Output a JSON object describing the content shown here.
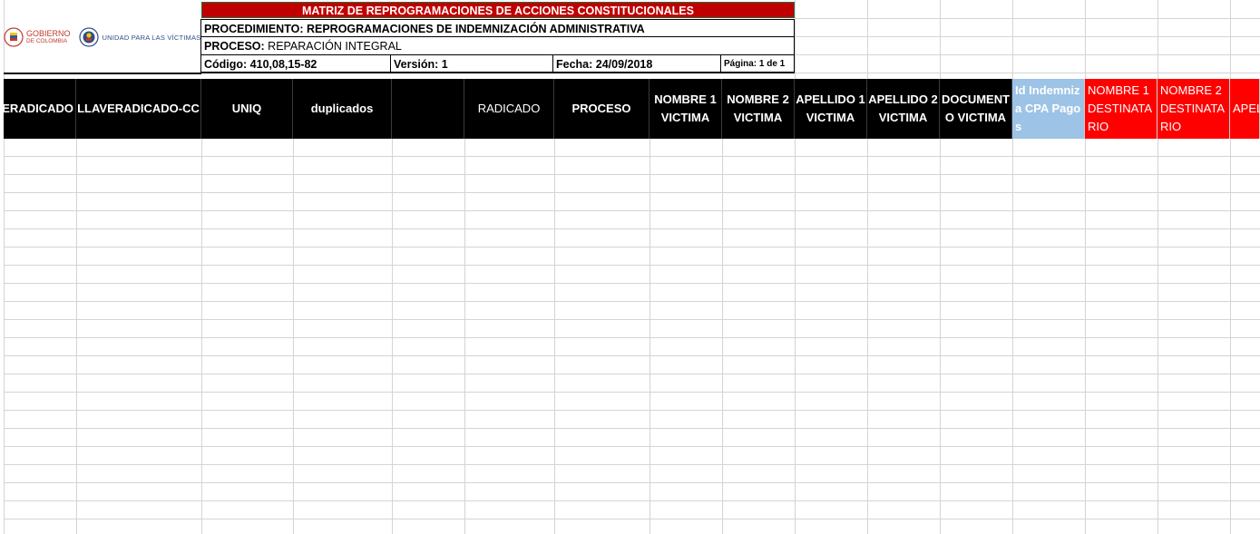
{
  "logos": {
    "gobierno_line1": "GOBIERNO",
    "gobierno_line2": "DE COLOMBIA",
    "unidad": "UNIDAD PARA LAS VÍCTIMAS"
  },
  "form": {
    "title": "MATRIZ DE REPROGRAMACIONES DE ACCIONES CONSTITUCIONALES",
    "procedimiento_label": "PROCEDIMIENTO:",
    "procedimiento_value": " REPROGRAMACIONES DE INDEMNIZACIÓN ADMINISTRATIVA",
    "proceso_label": "PROCESO:",
    "proceso_value": " REPARACIÓN INTEGRAL",
    "codigo": "Código: 410,08,15-82",
    "version": "Versión: 1",
    "fecha": "Fecha: 24/09/2018",
    "pagina": "Página: 1 de 1"
  },
  "columns": [
    "VERADICADO",
    "LLAVERADICADO-CC",
    "UNIQ",
    "duplicados",
    "",
    "RADICADO",
    "PROCESO",
    "NOMBRE 1 VICTIMA",
    "NOMBRE 2 VICTIMA",
    "APELLIDO 1 VICTIMA",
    "APELLIDO 2 VICTIMA",
    "DOCUMENTO VICTIMA",
    "Id Indemniza CPA Pagos",
    "NOMBRE 1 DESTINATARIO",
    "NOMBRE 2 DESTINATARIO",
    "APELLIDO"
  ],
  "colors": {
    "title_bg": "#c00000",
    "header_bg": "#000000",
    "id_header_bg": "#9dc3e6",
    "dest_header_bg": "#ff0000"
  }
}
